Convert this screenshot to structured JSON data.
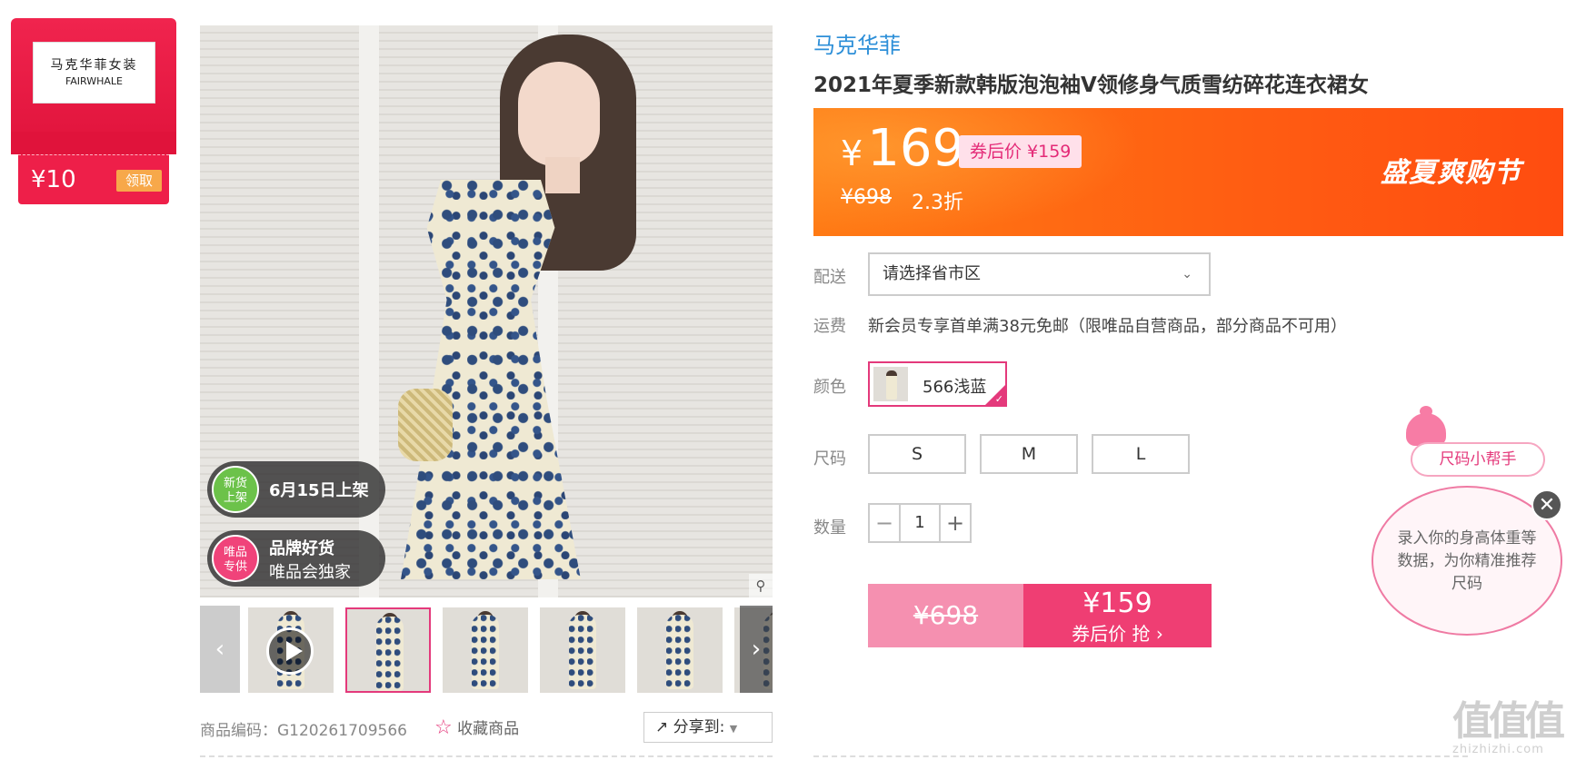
{
  "coupon": {
    "logo_cn": "马克华菲女装",
    "logo_en": "FAIRWHALE",
    "amount": "¥10",
    "get_label": "领取"
  },
  "gallery": {
    "badge_new": {
      "circle": "新货\n上架",
      "text": "6月15日上架"
    },
    "badge_brand": {
      "circle": "唯品\n专供",
      "line1": "品牌好货",
      "line2": "唯品会独家"
    },
    "thumbnail_count": 6,
    "active_thumbnail": 2
  },
  "meta": {
    "sku_code": "商品编码：G120261709566",
    "favorite_label": "收藏商品",
    "share_label": "分享到:"
  },
  "product": {
    "brand": "马克华菲",
    "title": "2021年夏季新款韩版泡泡袖V领修身气质雪纺碎花连衣裙女",
    "price_currency": "¥",
    "price": "169",
    "coupon_price": "券后价 ¥159",
    "original_price": "¥698",
    "discount": "2.3折",
    "promo_title": "盛夏爽购节"
  },
  "options": {
    "delivery_label": "配送",
    "region_placeholder": "请选择省市区",
    "shipping_label": "运费",
    "shipping_text": "新会员专享首单满38元免邮（限唯品自营商品，部分商品不可用）",
    "color_label": "颜色",
    "color_value": "566浅蓝",
    "size_label": "尺码",
    "sizes": [
      "S",
      "M",
      "L"
    ],
    "qty_label": "数量",
    "qty_minus": "−",
    "qty_value": "1",
    "qty_plus": "+"
  },
  "buy": {
    "left_price": "¥698",
    "right_price": "¥159",
    "right_label": "券后价 抢 ›"
  },
  "size_helper": {
    "tag": "尺码小帮手",
    "message": "录入你的身高体重等数据，为你精准推荐尺码",
    "close": "✕"
  },
  "watermark": {
    "main": "值值值",
    "sub": "zhizhizhi.com"
  },
  "colors": {
    "accent_pink": "#e4397b",
    "price_orange": "#ff5c12",
    "brand_blue": "#2d8fd8",
    "coupon_red": "#ee1f49"
  }
}
